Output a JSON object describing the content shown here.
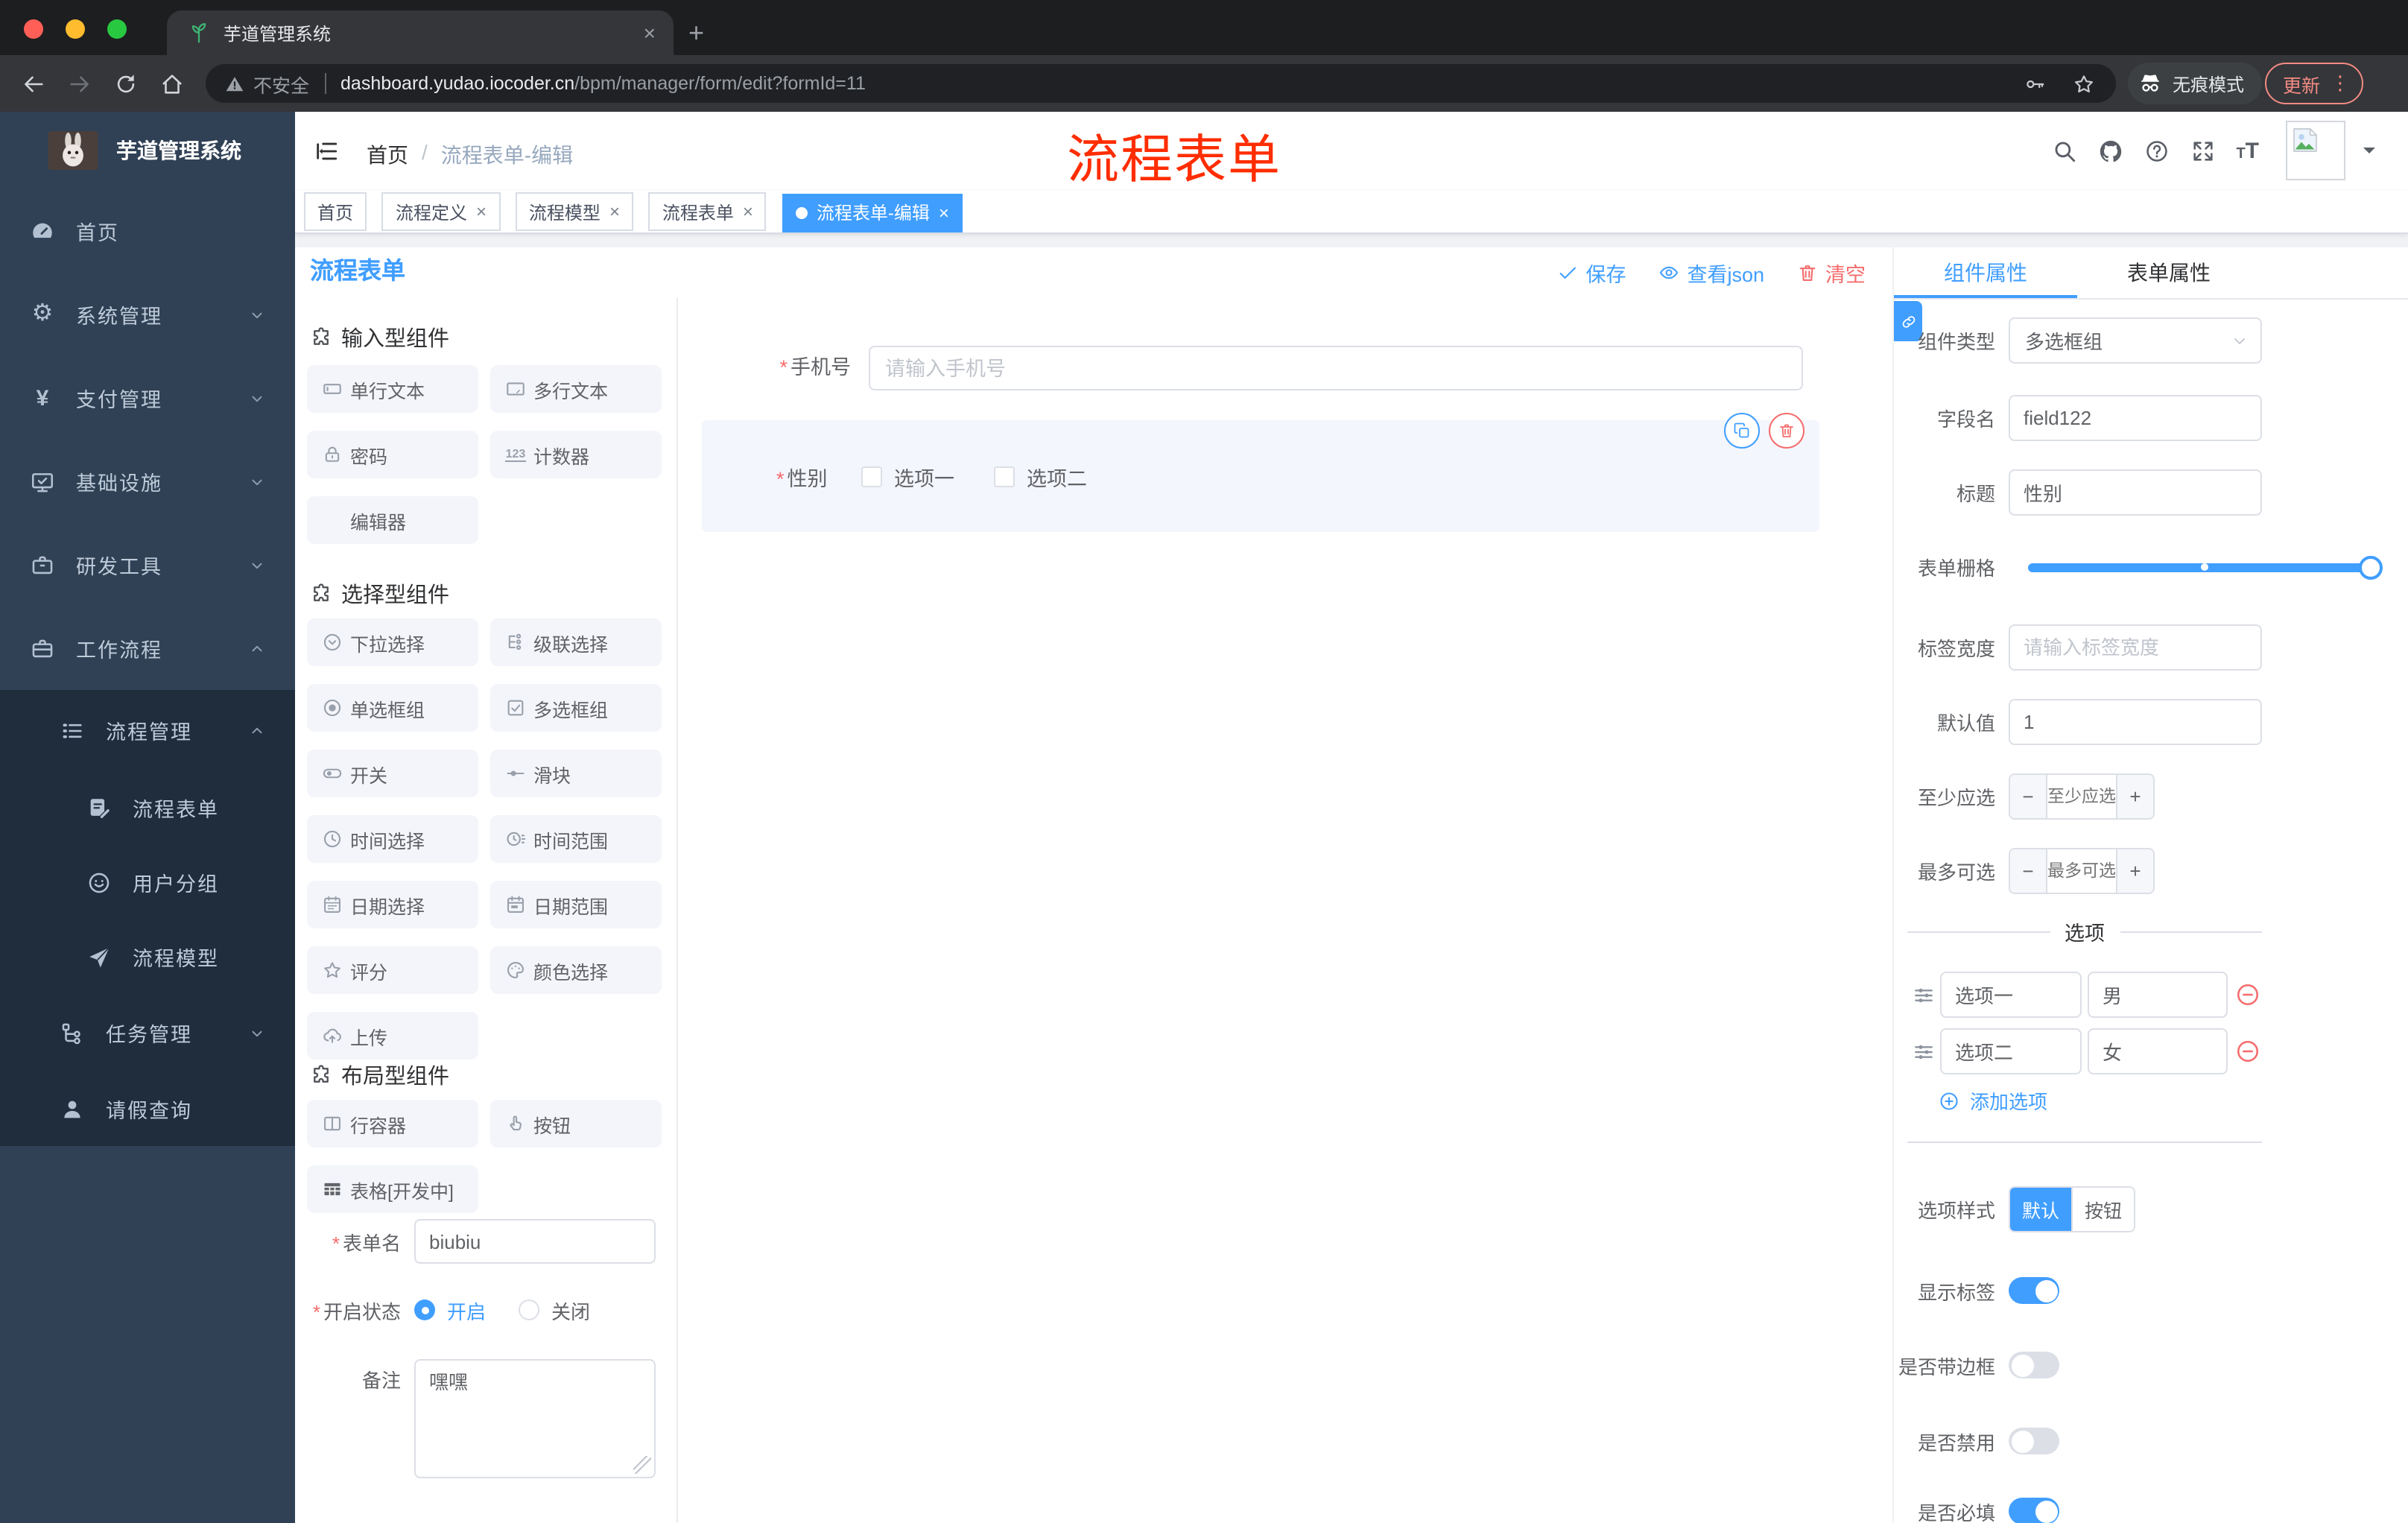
{
  "browser": {
    "tab_title": "芋道管理系统",
    "security_label": "不安全",
    "url_host": "dashboard.yudao.iocoder.cn",
    "url_path": "/bpm/manager/form/edit?formId=11",
    "incognito_label": "无痕模式",
    "update_label": "更新"
  },
  "icons": {
    "close": "×",
    "plus": "+",
    "ellipsis": "⋮",
    "gear": "⚙",
    "yen": "¥",
    "slash": "/",
    "minus": "−",
    "plus_sign": "+",
    "counter": "123",
    "font_big": "T",
    "font_small": "T"
  },
  "sidebar": {
    "logo_title": "芋道管理系统",
    "items": [
      {
        "label": "首页"
      },
      {
        "label": "系统管理"
      },
      {
        "label": "支付管理"
      },
      {
        "label": "基础设施"
      },
      {
        "label": "研发工具"
      },
      {
        "label": "工作流程"
      },
      {
        "label": "流程管理"
      },
      {
        "label": "流程表单"
      },
      {
        "label": "用户分组"
      },
      {
        "label": "流程模型"
      },
      {
        "label": "任务管理"
      },
      {
        "label": "请假查询"
      }
    ]
  },
  "header": {
    "breadcrumb_home": "首页",
    "breadcrumb_current": "流程表单-编辑",
    "annotation": "流程表单"
  },
  "tags": [
    {
      "label": "首页",
      "closable": false,
      "active": false
    },
    {
      "label": "流程定义",
      "closable": true,
      "active": false
    },
    {
      "label": "流程模型",
      "closable": true,
      "active": false
    },
    {
      "label": "流程表单",
      "closable": true,
      "active": false
    },
    {
      "label": "流程表单-编辑",
      "closable": true,
      "active": true
    }
  ],
  "designer": {
    "title": "流程表单",
    "save_label": "保存",
    "view_json_label": "查看json",
    "clear_label": "清空",
    "sections": [
      {
        "title": "输入型组件",
        "items": [
          "单行文本",
          "多行文本",
          "密码",
          "计数器",
          "编辑器"
        ]
      },
      {
        "title": "选择型组件",
        "items": [
          "下拉选择",
          "级联选择",
          "单选框组",
          "多选框组",
          "开关",
          "滑块",
          "时间选择",
          "时间范围",
          "日期选择",
          "日期范围",
          "评分",
          "颜色选择",
          "上传"
        ]
      },
      {
        "title": "布局型组件",
        "items": [
          "行容器",
          "按钮",
          "表格[开发中]"
        ]
      }
    ],
    "form": {
      "name_label": "表单名",
      "name_value": "biubiu",
      "status_label": "开启状态",
      "status_on": "开启",
      "status_off": "关闭",
      "remark_label": "备注",
      "remark_value": "嘿嘿"
    },
    "canvas": {
      "phone_label": "手机号",
      "phone_placeholder": "请输入手机号",
      "gender_label": "性别",
      "option1": "选项一",
      "option2": "选项二"
    }
  },
  "panel": {
    "tab_component": "组件属性",
    "tab_form": "表单属性",
    "type_label": "组件类型",
    "type_value": "多选框组",
    "field_label": "字段名",
    "field_value": "field122",
    "title_label": "标题",
    "title_value": "性别",
    "grid_label": "表单栅格",
    "width_label": "标签宽度",
    "width_placeholder": "请输入标签宽度",
    "default_label": "默认值",
    "default_value": "1",
    "min_label": "至少应选",
    "min_placeholder": "至少应选",
    "max_label": "最多可选",
    "max_placeholder": "最多可选",
    "options_title": "选项",
    "options": [
      {
        "text": "选项一",
        "value": "男"
      },
      {
        "text": "选项二",
        "value": "女"
      }
    ],
    "add_option": "添加选项",
    "style_label": "选项样式",
    "style_default": "默认",
    "style_button": "按钮",
    "toggles": [
      {
        "label": "显示标签",
        "on": true
      },
      {
        "label": "是否带边框",
        "on": false
      },
      {
        "label": "是否禁用",
        "on": false
      },
      {
        "label": "是否必填",
        "on": true
      }
    ]
  },
  "colors": {
    "accent": "#409eff",
    "danger": "#f56c6c",
    "annotation": "#ff2d00",
    "sidebar": "#304156",
    "submenu": "#1f2d3d"
  }
}
